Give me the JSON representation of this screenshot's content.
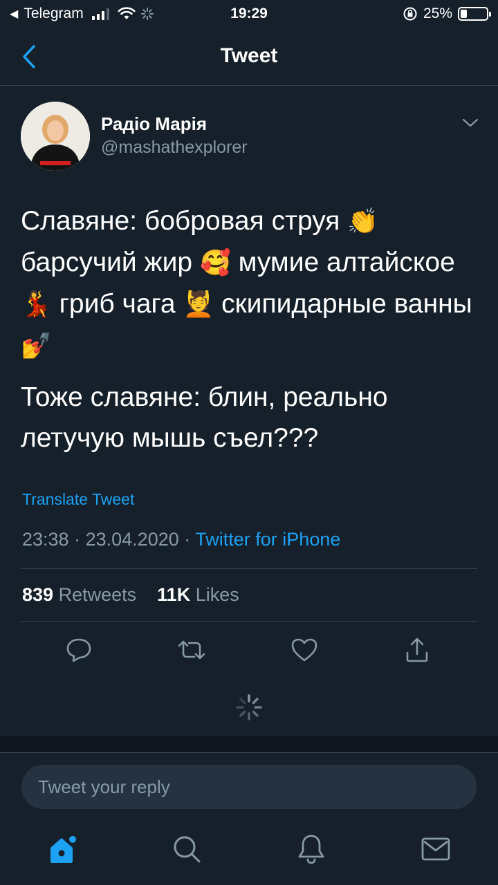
{
  "status_bar": {
    "back_app": "Telegram",
    "time": "19:29",
    "battery": "25%",
    "battery_level": 0.25
  },
  "nav": {
    "title": "Tweet"
  },
  "tweet": {
    "author_name": "Радіо Марія",
    "handle": "@mashathexplorer",
    "paragraph1": [
      {
        "text": "Славяне: бобровая струя ",
        "emoji": "👏"
      },
      {
        "text": " барсучий жир ",
        "emoji": "🥰"
      },
      {
        "text": " мумие алтайское ",
        "emoji": "💃"
      },
      {
        "text": " гриб чага ",
        "emoji": "💆"
      },
      {
        "text": " скипидарные ванны ",
        "emoji": "💅"
      }
    ],
    "paragraph2": "Тоже славяне: блин, реально летучую мышь съел???",
    "translate": "Translate Tweet",
    "time": "23:38",
    "separator": "·",
    "date": "23.04.2020",
    "client": "Twitter for iPhone",
    "retweets_count": "839",
    "retweets_label": "Retweets",
    "likes_count": "11K",
    "likes_label": "Likes"
  },
  "reply": {
    "placeholder": "Tweet your reply"
  },
  "icons": {
    "accent": "#1da1f2",
    "secondary": "#8899a6"
  }
}
